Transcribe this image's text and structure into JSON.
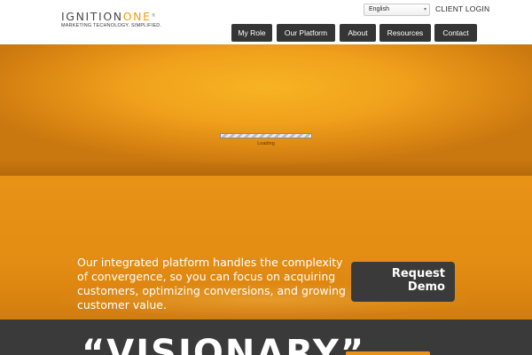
{
  "header": {
    "logo": {
      "name_main": "IGNITION",
      "name_accent": "ONE",
      "registered": "®",
      "tagline": "MARKETING TECHNOLOGY. SIMPLIFIED."
    },
    "language_select": {
      "value": "English",
      "caret": "▾"
    },
    "client_login": "CLIENT LOGIN",
    "nav": [
      {
        "label": "My Role"
      },
      {
        "label": "Our Platform"
      },
      {
        "label": "About"
      },
      {
        "label": "Resources"
      },
      {
        "label": "Contact"
      }
    ]
  },
  "hero": {
    "loading_text": "Loading",
    "loading_progress": 1.0
  },
  "promo": {
    "tagline": "Our integrated platform handles the complexity of convergence, so you can focus on acquiring customers, optimizing conversions, and growing customer value.",
    "demo_button": {
      "line1": "Request",
      "line2": "Demo"
    }
  },
  "quote": {
    "text": "“VISIONARY”"
  },
  "colors": {
    "accent": "#f39c12",
    "hero_orange": "#f0a11c",
    "nav_bg": "#353535",
    "dark_section": "#3a3a3a"
  }
}
